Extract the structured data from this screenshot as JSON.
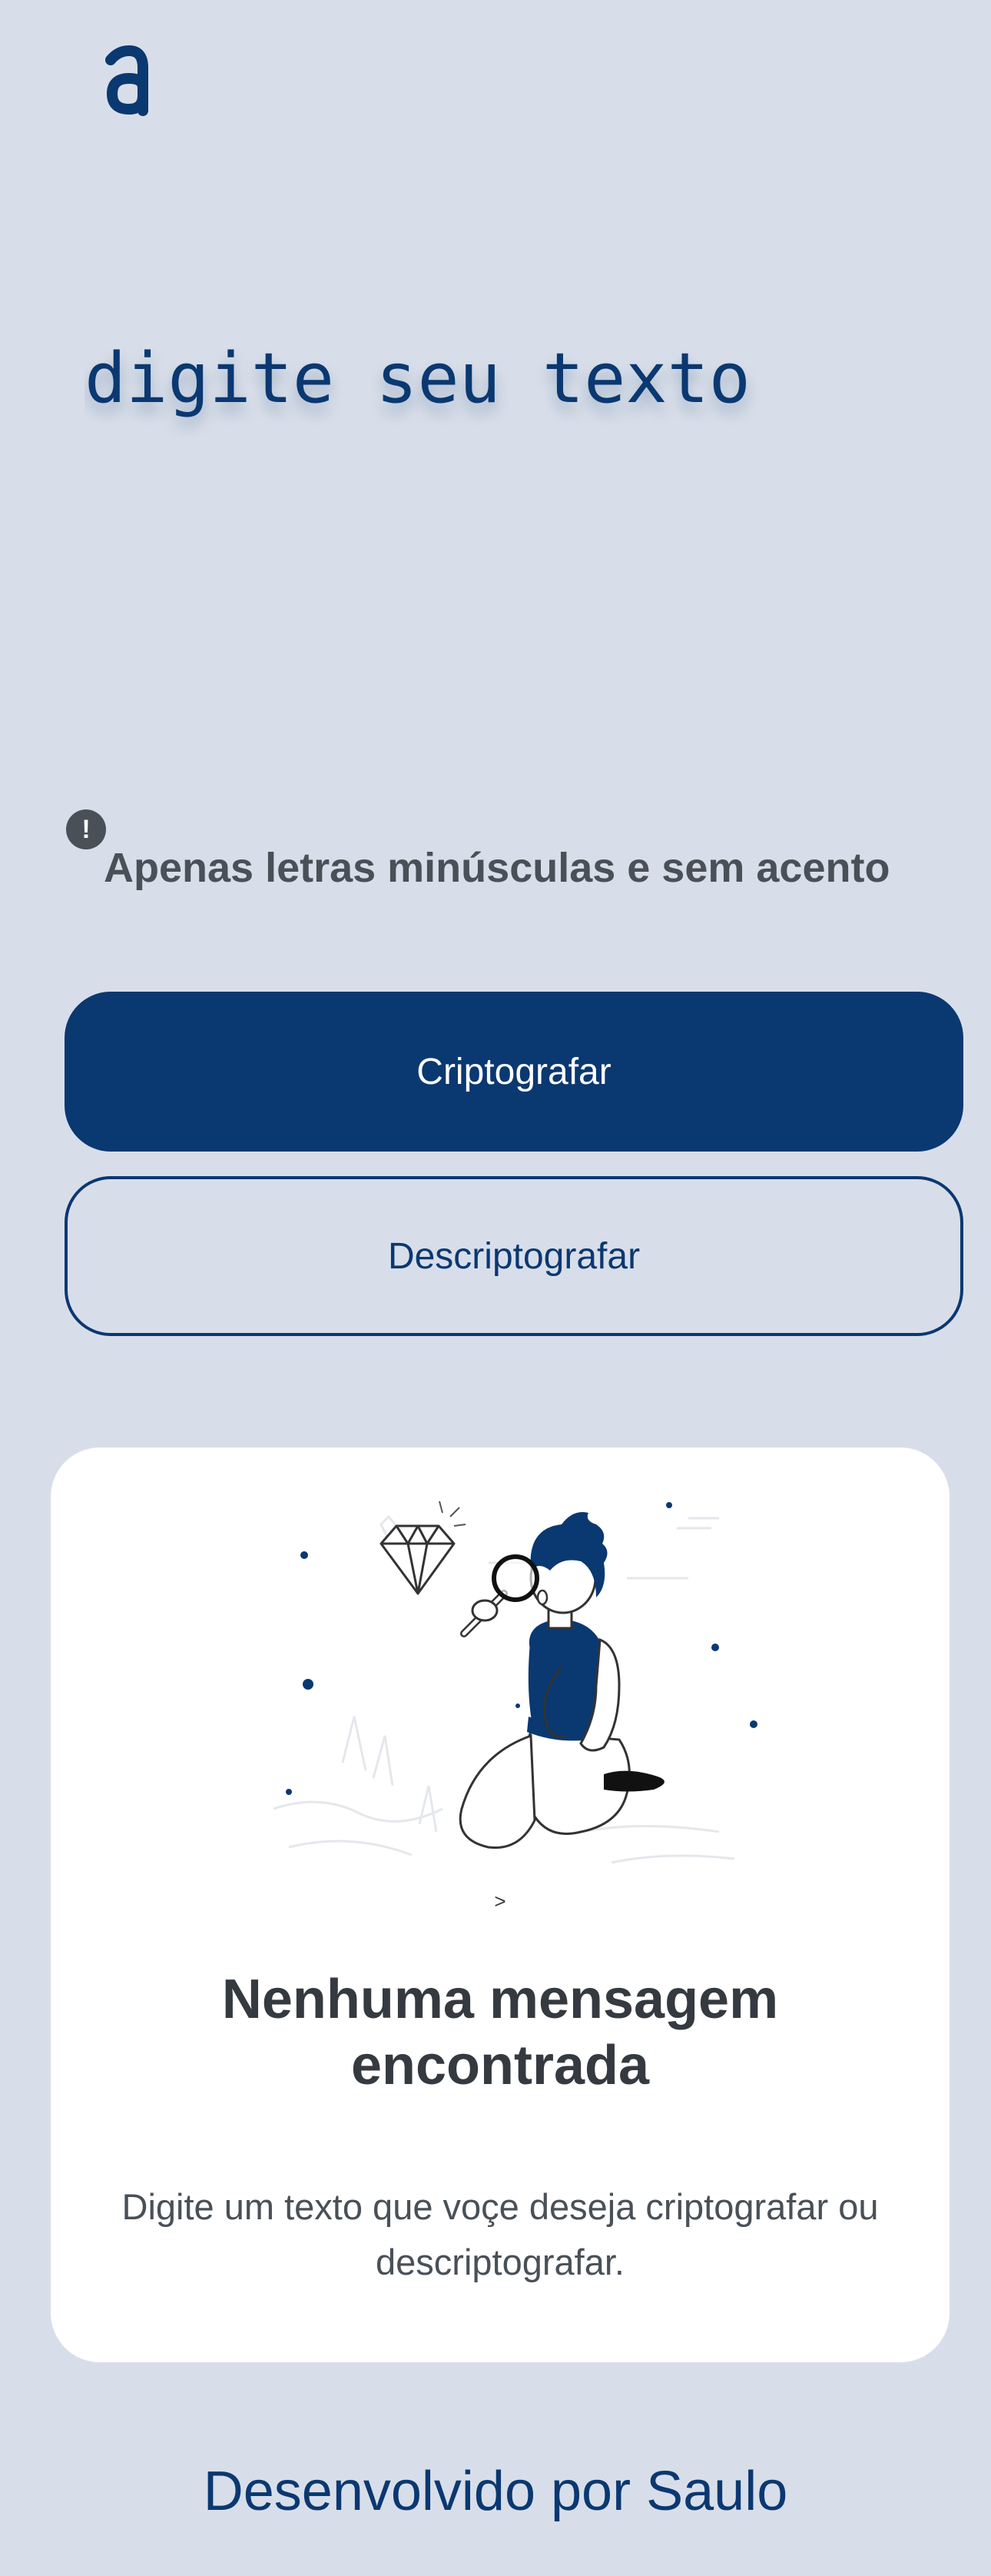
{
  "header": {
    "logo_icon": "alura-a-logo"
  },
  "input": {
    "placeholder": "digite seu texto",
    "value": ""
  },
  "hint": {
    "icon": "exclamation-circle-icon",
    "icon_glyph": "!",
    "text": "Apenas letras minúsculas e sem acento"
  },
  "actions": {
    "encrypt_label": "Criptografar",
    "decrypt_label": "Descriptografar"
  },
  "output": {
    "illustration": "boy-with-magnifier-illustration",
    "caption": ">",
    "title": "Nenhuma mensagem encontrada",
    "description": "Digite um texto que voçe deseja criptografar ou descriptografar."
  },
  "footer": {
    "text": "Desenvolvido por Saulo"
  },
  "colors": {
    "background": "#d8dee9",
    "primary": "#0a3871",
    "text_gray": "#495057",
    "title_dark": "#343a40",
    "card": "#ffffff"
  }
}
